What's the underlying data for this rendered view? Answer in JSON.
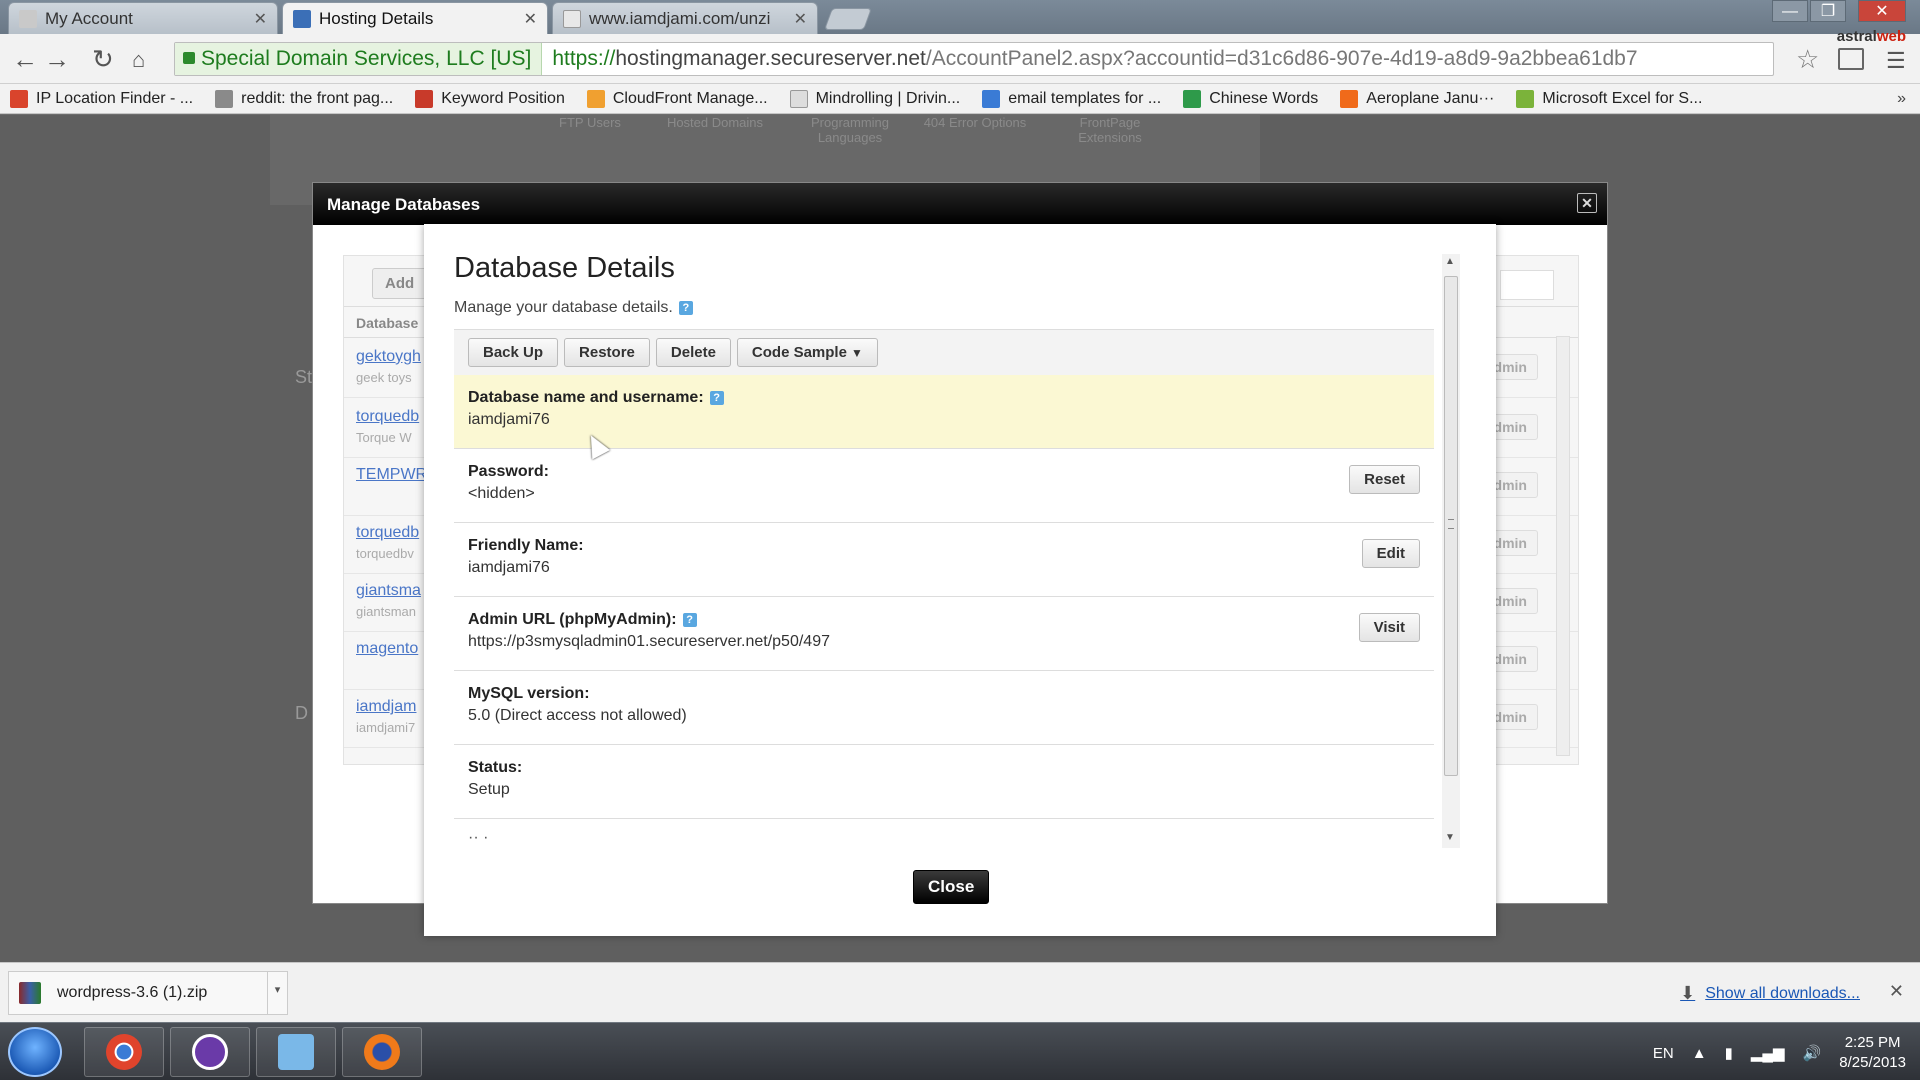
{
  "browser": {
    "tabs": [
      {
        "label": "My Account",
        "active": false
      },
      {
        "label": "Hosting Details",
        "active": true
      },
      {
        "label": "www.iamdjami.com/unzi",
        "active": false
      }
    ],
    "window_buttons": {
      "minimize": "—",
      "restore": "❐",
      "close": "✕"
    },
    "ev_label": "Special Domain Services, LLC [US]",
    "url_scheme": "https://",
    "url_host": "hostingmanager.secureserver.net",
    "url_path": "/AccountPanel2.aspx?accountid=d31c6d86-907e-4d19-a8d9-9a2bbea61db7",
    "extension_label": "astralweb",
    "extension_label_a": "astral",
    "extension_label_b": "web",
    "bookmarks": [
      {
        "label": "IP Location Finder - ...",
        "color": "#d9442c"
      },
      {
        "label": "reddit: the front pag...",
        "color": "#8a8a8a"
      },
      {
        "label": "Keyword Position",
        "color": "#c83a2a"
      },
      {
        "label": "CloudFront Manage...",
        "color": "#f0a030"
      },
      {
        "label": "Mindrolling | Drivin...",
        "color": "#bbbbbb"
      },
      {
        "label": "email templates for ...",
        "color": "#3a7bd5"
      },
      {
        "label": "Chinese Words",
        "color": "#2e9a4a"
      },
      {
        "label": "Aeroplane Janu···",
        "color": "#f06a1a"
      },
      {
        "label": "Microsoft Excel for S...",
        "color": "#7bb33a"
      }
    ],
    "bookmarks_more": "»"
  },
  "background_page": {
    "nav": [
      "FTP Users",
      "Hosted Domains",
      "Programming Languages",
      "404 Error Options",
      "FrontPage Extensions"
    ]
  },
  "outer_modal": {
    "title": "Manage Databases",
    "close_glyph": "✕",
    "add_label": "Add",
    "column_header": "Database",
    "rows": [
      {
        "link": "gektoygh",
        "sub": "geek toys"
      },
      {
        "link": "torquedb",
        "sub": "Torque W"
      },
      {
        "link": "TEMPWR",
        "sub": ""
      },
      {
        "link": "torquedb",
        "sub": "torquedbv"
      },
      {
        "link": "giantsma",
        "sub": "giantsman"
      },
      {
        "link": "magento",
        "sub": ""
      },
      {
        "link": "iamdjam",
        "sub": "iamdjami7"
      }
    ],
    "admin_label": "dmin",
    "side_letters": [
      "St",
      "D"
    ]
  },
  "inner_modal": {
    "title": "Database Details",
    "subtitle": "Manage your database details.",
    "help_glyph": "?",
    "actions": {
      "backup": "Back Up",
      "restore": "Restore",
      "delete": "Delete",
      "code_sample": "Code Sample",
      "code_sample_caret": "▼"
    },
    "fields": {
      "name": {
        "label": "Database name and username:",
        "value": "iamdjami76"
      },
      "password": {
        "label": "Password:",
        "value": "<hidden>",
        "button": "Reset"
      },
      "friendly": {
        "label": "Friendly Name:",
        "value": "iamdjami76",
        "button": "Edit"
      },
      "admin_url": {
        "label": "Admin URL (phpMyAdmin):",
        "value": "https://p3smysqladmin01.secureserver.net/p50/497",
        "button": "Visit"
      },
      "mysql": {
        "label": "MySQL version:",
        "value": "5.0 (Direct access not allowed)"
      },
      "status": {
        "label": "Status:",
        "value": "Setup"
      }
    },
    "partial_row": "·· ·",
    "scroll_up": "▲",
    "scroll_down": "▼",
    "close_label": "Close"
  },
  "downloads": {
    "file": "wordpress-3.6 (1).zip",
    "caret": "▾",
    "show_all": "Show all downloads...",
    "close_glyph": "✕"
  },
  "taskbar": {
    "language": "EN",
    "time": "2:25 PM",
    "date": "8/25/2013",
    "apps": [
      {
        "name": "chrome",
        "color": "#e0442c"
      },
      {
        "name": "vpn",
        "color": "#6a3aa8"
      },
      {
        "name": "paint",
        "color": "#7ab8e8"
      },
      {
        "name": "firefox",
        "color": "#f07a1a"
      }
    ]
  }
}
